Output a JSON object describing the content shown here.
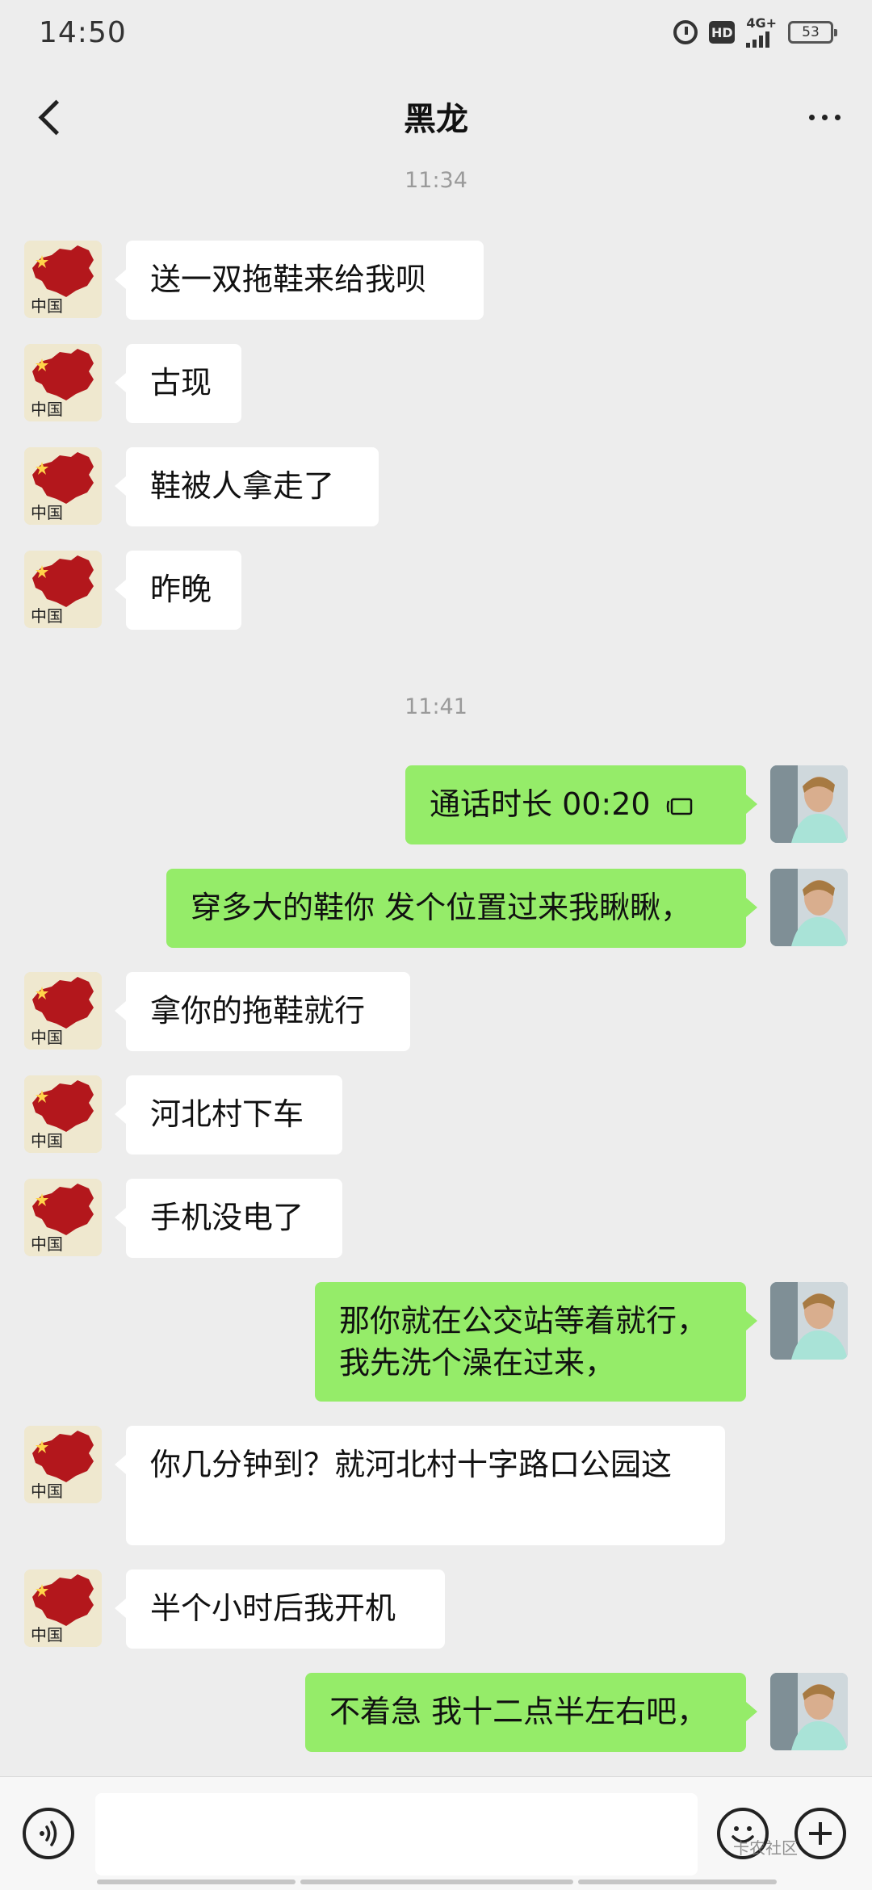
{
  "status_bar": {
    "time": "14:50",
    "network": "4G+",
    "battery": "53"
  },
  "header": {
    "title": "黑龙"
  },
  "messages": [
    {
      "type": "time",
      "text": "11:34"
    },
    {
      "type": "msg",
      "side": "in",
      "text": "送一双拖鞋来给我呗"
    },
    {
      "type": "msg",
      "side": "in",
      "text": "古现"
    },
    {
      "type": "msg",
      "side": "in",
      "text": "鞋被人拿走了"
    },
    {
      "type": "msg",
      "side": "in",
      "text": "昨晚"
    },
    {
      "type": "time",
      "text": "11:41"
    },
    {
      "type": "msg",
      "side": "out",
      "text": "通话时长 00:20",
      "icon": "voice-call-icon"
    },
    {
      "type": "msg",
      "side": "out",
      "text": "穿多大的鞋你 发个位置过来我瞅瞅，"
    },
    {
      "type": "msg",
      "side": "in",
      "text": "拿你的拖鞋就行"
    },
    {
      "type": "msg",
      "side": "in",
      "text": "河北村下车"
    },
    {
      "type": "msg",
      "side": "in",
      "text": "手机没电了"
    },
    {
      "type": "msg",
      "side": "out",
      "text": "那你就在公交站等着就行，我先洗个澡在过来，"
    },
    {
      "type": "msg",
      "side": "in",
      "text": "你几分钟到？就河北村十字路口公园这"
    },
    {
      "type": "msg",
      "side": "in",
      "text": "半个小时后我开机"
    },
    {
      "type": "msg",
      "side": "out",
      "text": "不着急 我十二点半左右吧，"
    }
  ],
  "input_bar": {
    "message_value": "",
    "watermark_text": "卡农社区"
  },
  "colors": {
    "background": "#ededed",
    "bubble_out": "#95ec69",
    "bubble_in": "#ffffff"
  }
}
